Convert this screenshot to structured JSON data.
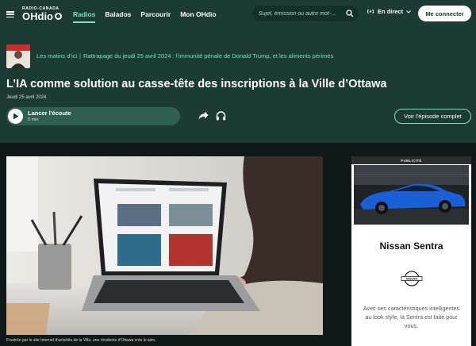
{
  "nav": {
    "logo_top": "RADIO-CANADA",
    "logo_main": "OHdio",
    "links": [
      {
        "label": "Radios",
        "active": true
      },
      {
        "label": "Balados",
        "active": false
      },
      {
        "label": "Parcourir",
        "active": false
      },
      {
        "label": "Mon OHdio",
        "active": false
      }
    ],
    "search_placeholder": "Sujet, émission ou autre mot-…",
    "live_label": "En direct",
    "connect_label": "Me connecter"
  },
  "episode": {
    "show_name": "Les matins d'ici",
    "rebroadcast": "Rattrapage du jeudi 25 avril 2024 : l'immunité pénale de Donald Trump, et les aliments périmés",
    "title": "L’IA comme solution au casse-tête des inscriptions à la Ville d’Ottawa",
    "date": "Jeudi 25 avril 2024",
    "listen_label": "Lancer l'écoute",
    "duration": "5 min",
    "full_episode_label": "Voir l'épisode complet"
  },
  "media": {
    "caption": "Frustrée par le site Internet d'activités de la Ville, une résidente d'Ottawa crée le sien."
  },
  "ad": {
    "label": "PUBLICITÉ",
    "title": "Nissan Sentra",
    "brand": "NISSAN",
    "text": "Avec ses caractéristiques intelligentes au look style, la Sentra est faite pour vous."
  },
  "colors": {
    "nav_bg": "#1b3b33",
    "accent": "#7ee0c2",
    "page_bg": "#0f1a18",
    "listen_bg": "#2f5e52"
  }
}
